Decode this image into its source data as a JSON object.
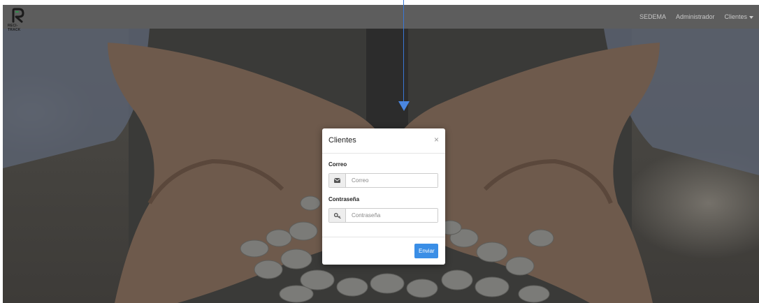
{
  "navbar": {
    "logo_text": "RECI-TRACK",
    "links": [
      {
        "label": "SEDEMA"
      },
      {
        "label": "Administrador"
      },
      {
        "label": "Clientes"
      }
    ]
  },
  "modal": {
    "title": "Clientes",
    "close_symbol": "×",
    "fields": [
      {
        "label": "Correo",
        "placeholder": "Correo",
        "icon": "envelope-icon"
      },
      {
        "label": "Contraseña",
        "placeholder": "Contraseña",
        "icon": "key-icon"
      }
    ],
    "submit_label": "Enviar"
  },
  "colors": {
    "navbar_bg": "#5d5d5d",
    "submit_bg": "#3a8ee6",
    "arrow": "#3a78d6"
  }
}
